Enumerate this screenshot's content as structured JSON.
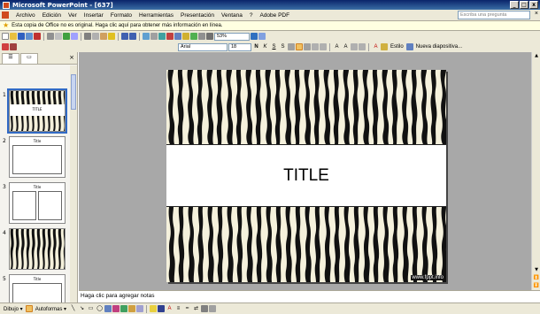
{
  "window": {
    "title": "Microsoft PowerPoint - [637]"
  },
  "menu": {
    "items": [
      "Archivo",
      "Edición",
      "Ver",
      "Insertar",
      "Formato",
      "Herramientas",
      "Presentación",
      "Ventana",
      "?",
      "Adobe PDF"
    ],
    "ask_placeholder": "Escriba una pregunta",
    "close_glyph": "×"
  },
  "infobar": {
    "text": "Esta copia de Office no es original. Haga clic aquí para obtener más información en línea."
  },
  "toolbar": {
    "zoom": "53%",
    "font": "Arial",
    "size": "18",
    "bold": "N",
    "italic": "K",
    "underline": "S",
    "shadow": "S",
    "style_label": "Estilo",
    "new_slide_label": "Nueva diapositiva..."
  },
  "pane": {
    "tab_outline": "☰",
    "tab_slides": "▭",
    "close_glyph": "×",
    "thumbnails": [
      {
        "number": "1",
        "title": "TITLE"
      },
      {
        "number": "2",
        "title": "Title"
      },
      {
        "number": "3",
        "title": "Title"
      },
      {
        "number": "4",
        "title": ""
      },
      {
        "number": "5",
        "title": "Title"
      }
    ]
  },
  "slide": {
    "title": "TITLE",
    "credit": "www.fppt.info"
  },
  "notes": {
    "placeholder": "Haga clic para agregar notas"
  },
  "drawbar": {
    "draw_label": "Dibujo ▾",
    "autoshapes_label": "Autoformas ▾"
  },
  "colors": {
    "titlebar": "#0a246a",
    "toolbar": "#ece9d8",
    "selection": "#316ac5"
  }
}
